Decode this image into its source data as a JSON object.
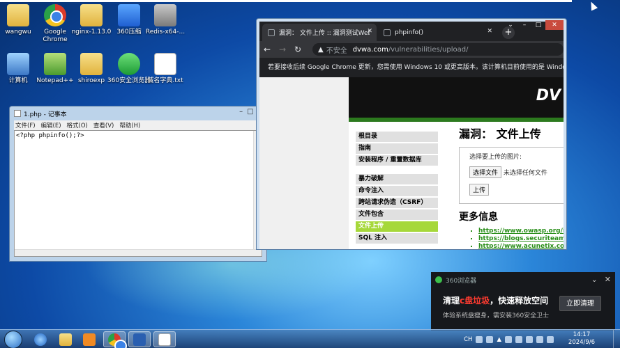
{
  "desktop": {
    "icons": [
      {
        "label": "wangwu",
        "icon": "folder-icon"
      },
      {
        "label": "Google Chrome",
        "icon": "chrome-icon"
      },
      {
        "label": "nginx-1.13.0",
        "icon": "folder-icon"
      },
      {
        "label": "360压缩",
        "icon": "archive-icon"
      },
      {
        "label": "Redis-x64-...",
        "icon": "redis-icon"
      },
      {
        "label": "计算机",
        "icon": "computer-icon"
      },
      {
        "label": "Notepad++",
        "icon": "notepadpp-icon"
      },
      {
        "label": "shiroexp",
        "icon": "folder-icon"
      },
      {
        "label": "360安全浏览器",
        "icon": "browser360-icon"
      },
      {
        "label": "域名字典.txt",
        "icon": "text-file-icon"
      }
    ]
  },
  "notepad": {
    "title": "1.php - 记事本",
    "menu": [
      "文件(F)",
      "编辑(E)",
      "格式(O)",
      "查看(V)",
      "帮助(H)"
    ],
    "content": "<?php phpinfo();?>"
  },
  "chrome": {
    "tabs": [
      {
        "label": "漏洞： 文件上传 :: 漏洞测试Web",
        "active": true
      },
      {
        "label": "phpinfo()",
        "active": false
      }
    ],
    "address": {
      "security": "不安全",
      "domain": "dvwa.com",
      "path": "/vulnerabilities/upload/"
    },
    "infobar": "若要接收后续 Google Chrome 更新，您需使用 Windows 10 或更高版本。该计算机目前使用的是 Windo",
    "page": {
      "logo": "DV",
      "menu_group1": [
        "根目录",
        "指南",
        "安装程序 / 重置数据库"
      ],
      "menu_group2": [
        "暴力破解",
        "命令注入",
        "跨站请求伪造（CSRF）",
        "文件包含",
        "文件上传",
        "SQL 注入"
      ],
      "active_menu": "文件上传",
      "heading": "漏洞： 文件上传",
      "upload_prompt": "选择要上传的图片:",
      "choose_file": "选择文件",
      "no_file": "未选择任何文件",
      "upload_button": "上传",
      "more_info": "更多信息",
      "links": [
        "https://www.owasp.org/index",
        "https://blogs.securiteam.com",
        "https://www.acunetix.com/w"
      ]
    }
  },
  "notification": {
    "app": "360浏览器",
    "message_prefix": "清理",
    "message_highlight": "c盘垃圾",
    "message_suffix": "，快速释放空间",
    "sub": "体验系统盘瘦身，需安装360安全卫士",
    "cta": "立即清理"
  },
  "taskbar": {
    "lang": "CH",
    "time": "14:17",
    "date": "2024/9/6"
  }
}
